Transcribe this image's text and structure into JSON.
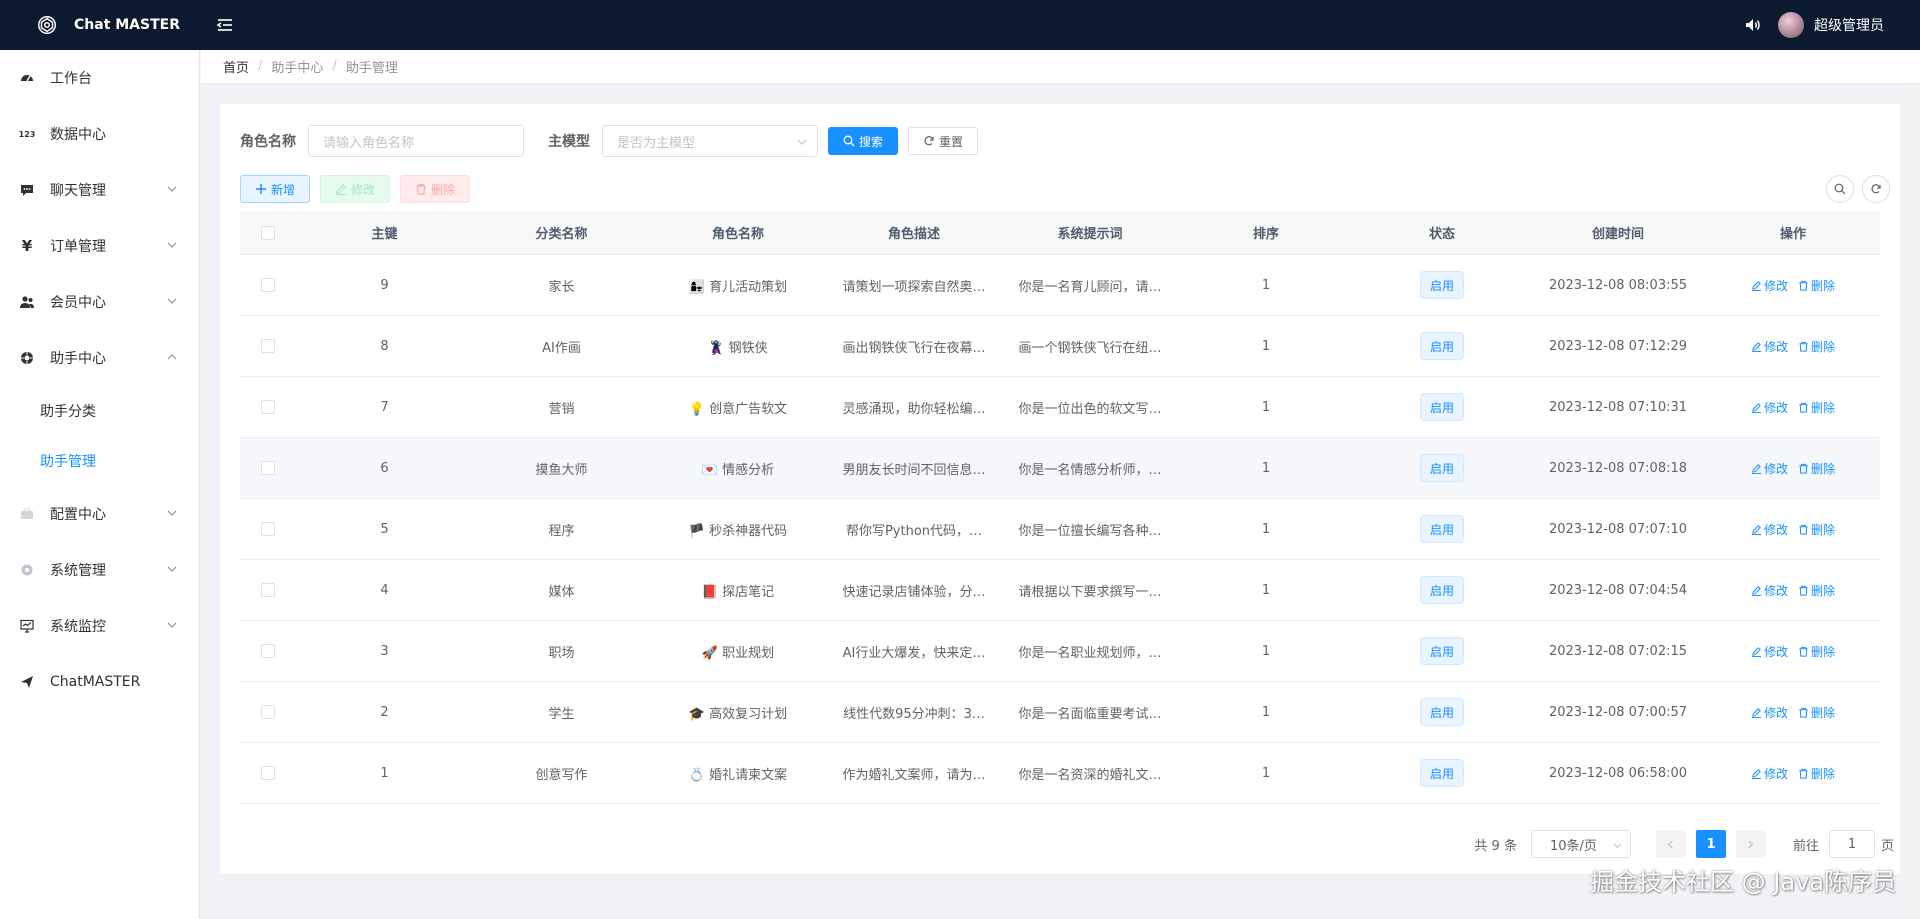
{
  "app": {
    "title": "Chat MASTER"
  },
  "header": {
    "user_name": "超级管理员"
  },
  "sidebar": {
    "items": [
      {
        "label": "工作台",
        "icon": "dashboard-icon"
      },
      {
        "label": "数据中心",
        "icon": "123-icon"
      },
      {
        "label": "聊天管理",
        "icon": "chat-icon"
      },
      {
        "label": "订单管理",
        "icon": "yen-icon"
      },
      {
        "label": "会员中心",
        "icon": "users-icon"
      },
      {
        "label": "助手中心",
        "icon": "lifebuoy-icon",
        "expanded": true
      },
      {
        "label": "配置中心",
        "icon": "briefcase-icon"
      },
      {
        "label": "系统管理",
        "icon": "gear-icon"
      },
      {
        "label": "系统监控",
        "icon": "monitor-icon"
      },
      {
        "label": "ChatMASTER",
        "icon": "send-icon"
      }
    ],
    "sub_items": [
      {
        "label": "助手分类",
        "active": false
      },
      {
        "label": "助手管理",
        "active": true
      }
    ]
  },
  "breadcrumb": {
    "home": "首页",
    "parent": "助手中心",
    "current": "助手管理",
    "sep": "/"
  },
  "filters": {
    "role_label": "角色名称",
    "role_placeholder": "请输入角色名称",
    "model_label": "主模型",
    "model_placeholder": "是否为主模型",
    "search_label": "搜索",
    "reset_label": "重置"
  },
  "toolbar": {
    "add_label": "新增",
    "edit_label": "修改",
    "delete_label": "删除"
  },
  "table": {
    "headers": [
      "主键",
      "分类名称",
      "角色名称",
      "角色描述",
      "系统提示词",
      "排序",
      "状态",
      "创建时间",
      "操作"
    ],
    "rows": [
      {
        "id": "9",
        "category": "家长",
        "emoji": "👩‍👧",
        "role": "育儿活动策划",
        "desc": "请策划一项探索自然奥…",
        "prompt": "你是一名育儿顾问，请…",
        "sort": "1",
        "status": "启用",
        "created": "2023-12-08 08:03:55"
      },
      {
        "id": "8",
        "category": "AI作画",
        "emoji": "🦹",
        "role": "钢铁侠",
        "desc": "画出钢铁侠飞行在夜幕…",
        "prompt": "画一个钢铁侠飞行在纽…",
        "sort": "1",
        "status": "启用",
        "created": "2023-12-08 07:12:29"
      },
      {
        "id": "7",
        "category": "营销",
        "emoji": "💡",
        "role": "创意广告软文",
        "desc": "灵感涌现，助你轻松编…",
        "prompt": "你是一位出色的软文写…",
        "sort": "1",
        "status": "启用",
        "created": "2023-12-08 07:10:31"
      },
      {
        "id": "6",
        "category": "摸鱼大师",
        "emoji": "💌",
        "role": "情感分析",
        "desc": "男朋友长时间不回信息…",
        "prompt": "你是一名情感分析师，…",
        "sort": "1",
        "status": "启用",
        "created": "2023-12-08 07:08:18"
      },
      {
        "id": "5",
        "category": "程序",
        "emoji": "🏴",
        "role": "秒杀神器代码",
        "desc": "帮你写Python代码，…",
        "prompt": "你是一位擅长编写各种…",
        "sort": "1",
        "status": "启用",
        "created": "2023-12-08 07:07:10"
      },
      {
        "id": "4",
        "category": "媒体",
        "emoji": "📕",
        "role": "探店笔记",
        "desc": "快速记录店铺体验，分…",
        "prompt": "请根据以下要求撰写一…",
        "sort": "1",
        "status": "启用",
        "created": "2023-12-08 07:04:54"
      },
      {
        "id": "3",
        "category": "职场",
        "emoji": "🚀",
        "role": "职业规划",
        "desc": "AI行业大爆发，快来定…",
        "prompt": "你是一名职业规划师，…",
        "sort": "1",
        "status": "启用",
        "created": "2023-12-08 07:02:15"
      },
      {
        "id": "2",
        "category": "学生",
        "emoji": "🎓",
        "role": "高效复习计划",
        "desc": "线性代数95分冲刺：3…",
        "prompt": "你是一名面临重要考试…",
        "sort": "1",
        "status": "启用",
        "created": "2023-12-08 07:00:57"
      },
      {
        "id": "1",
        "category": "创意写作",
        "emoji": "💍",
        "role": "婚礼请柬文案",
        "desc": "作为婚礼文案师，请为…",
        "prompt": "你是一名资深的婚礼文…",
        "sort": "1",
        "status": "启用",
        "created": "2023-12-08 06:58:00"
      }
    ],
    "op_edit": "修改",
    "op_delete": "删除"
  },
  "pagination": {
    "total_text": "共 9 条",
    "page_size": "10条/页",
    "current_page": "1",
    "goto_label": "前往",
    "goto_value": "1",
    "page_suffix": "页"
  },
  "watermark": "掘金技术社区 @ Java陈序员",
  "colors": {
    "primary": "#1890ff",
    "topbar": "#0b1a2f",
    "success_light": "#e7faf0",
    "danger_light": "#ffeded"
  }
}
